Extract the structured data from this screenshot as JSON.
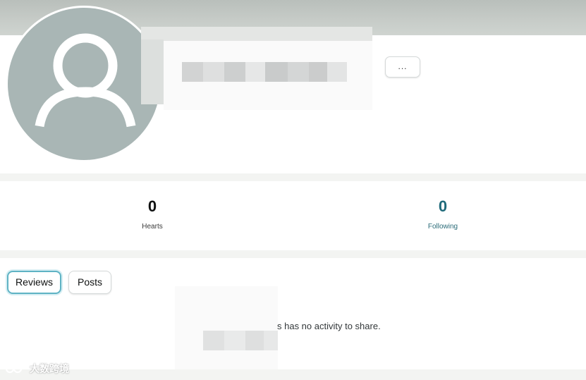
{
  "header": {
    "avatar_icon": "default-user-icon",
    "more_button_label": "..."
  },
  "stats": {
    "hearts": {
      "value": "0",
      "label": "Hearts"
    },
    "following": {
      "value": "0",
      "label": "Following"
    }
  },
  "activity": {
    "tabs": [
      {
        "label": "Reviews",
        "selected": true
      },
      {
        "label": "Posts",
        "selected": false
      }
    ],
    "empty_message": "s has no activity to share."
  },
  "watermark": {
    "text": "大数跨境"
  },
  "colors": {
    "avatar_bg": "#a9b6b5",
    "following_accent": "#1f6a7a",
    "selected_tab_border": "#5fb3c4"
  }
}
